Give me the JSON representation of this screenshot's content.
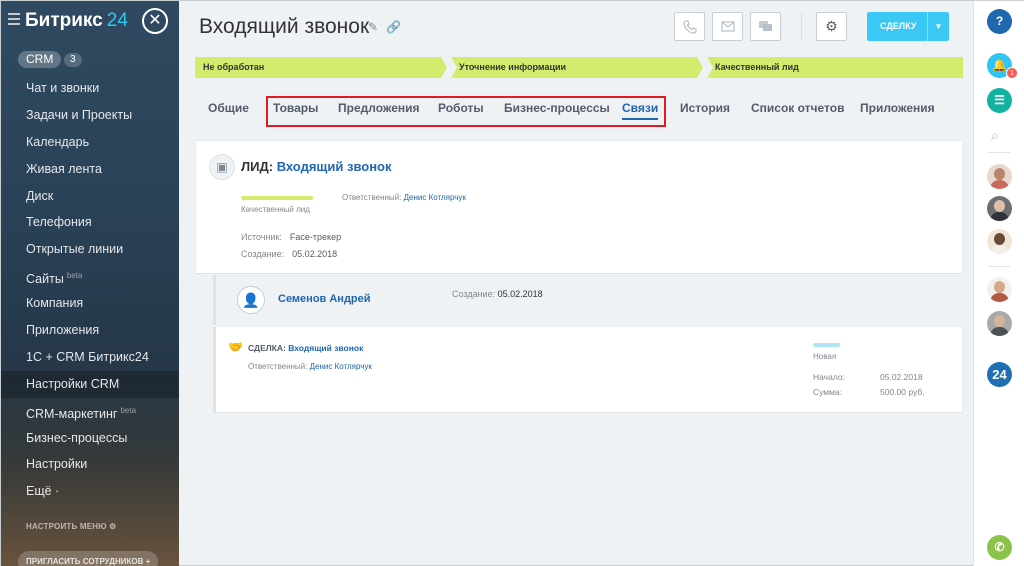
{
  "sidebar": {
    "logo_text": "Битрикс",
    "logo_num": "24",
    "crm_label": "CRM",
    "crm_count": "3",
    "items": [
      {
        "label": "Чат и звонки"
      },
      {
        "label": "Задачи и Проекты"
      },
      {
        "label": "Календарь"
      },
      {
        "label": "Живая лента"
      },
      {
        "label": "Диск"
      },
      {
        "label": "Телефония"
      },
      {
        "label": "Открытые линии"
      },
      {
        "label": "Сайты",
        "badge": "beta"
      },
      {
        "label": "Компания"
      },
      {
        "label": "Приложения"
      },
      {
        "label": "1С + CRM Битрикс24"
      },
      {
        "label": "Настройки CRM"
      },
      {
        "label": "CRM-маркетинг",
        "badge": "beta"
      },
      {
        "label": "Бизнес-процессы"
      },
      {
        "label": "Настройки"
      },
      {
        "label": "Ещё ·"
      }
    ],
    "configure_menu": "НАСТРОИТЬ МЕНЮ",
    "invite": "ПРИГЛАСИТЬ СОТРУДНИКОВ"
  },
  "header": {
    "title": "Входящий звонок",
    "deal_button": "СДЕЛКУ"
  },
  "stages": [
    "Не обработан",
    "Уточнение информации",
    "Качественный лид"
  ],
  "tabs": [
    {
      "label": "Общие"
    },
    {
      "label": "Товары"
    },
    {
      "label": "Предложения"
    },
    {
      "label": "Роботы"
    },
    {
      "label": "Бизнес-процессы"
    },
    {
      "label": "Связи"
    },
    {
      "label": "История"
    },
    {
      "label": "Список отчетов"
    },
    {
      "label": "Приложения"
    }
  ],
  "lead": {
    "prefix": "ЛИД:",
    "name": "Входящий звонок",
    "stage": "Качественный лид",
    "responsible_label": "Ответственный:",
    "responsible": "Денис Котлярчук",
    "source_label": "Источник:",
    "source": "Face-трекер",
    "created_label": "Создание:",
    "created": "05.02.2018"
  },
  "contact": {
    "name": "Семенов Андрей",
    "created_label": "Создание:",
    "created": "05.02.2018"
  },
  "deal": {
    "prefix": "СДЕЛКА:",
    "name": "Входящий звонок",
    "responsible_label": "Ответственный:",
    "responsible": "Денис Котлярчук",
    "stage": "Новая",
    "start_label": "Начало:",
    "start": "05.02.2018",
    "sum_label": "Сумма:",
    "sum": "500.00 руб."
  },
  "right_panel": {
    "help": "?",
    "notifications_count": "1",
    "b24": "24"
  },
  "colors": {
    "accent": "#2067b0",
    "stage": "#d3ec6d",
    "button": "#3bc8f5",
    "highlight": "#e21a22"
  }
}
